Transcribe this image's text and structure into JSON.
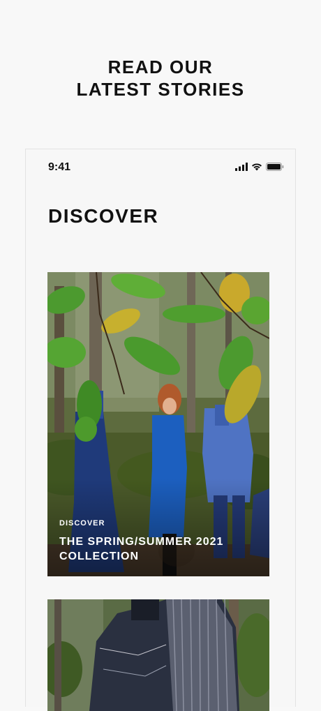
{
  "headline": {
    "line1": "READ OUR",
    "line2": "LATEST STORIES"
  },
  "status_bar": {
    "time": "9:41",
    "icons": [
      "cellular-signal-icon",
      "wifi-icon",
      "battery-icon"
    ]
  },
  "page": {
    "title": "DISCOVER"
  },
  "stories": [
    {
      "eyebrow": "DISCOVER",
      "title": "THE SPRING/SUMMER 2021 COLLECTION"
    },
    {
      "eyebrow": "",
      "title": ""
    }
  ],
  "colors": {
    "background": "#f8f8f8",
    "text": "#111111",
    "overlay_text": "#ffffff"
  }
}
